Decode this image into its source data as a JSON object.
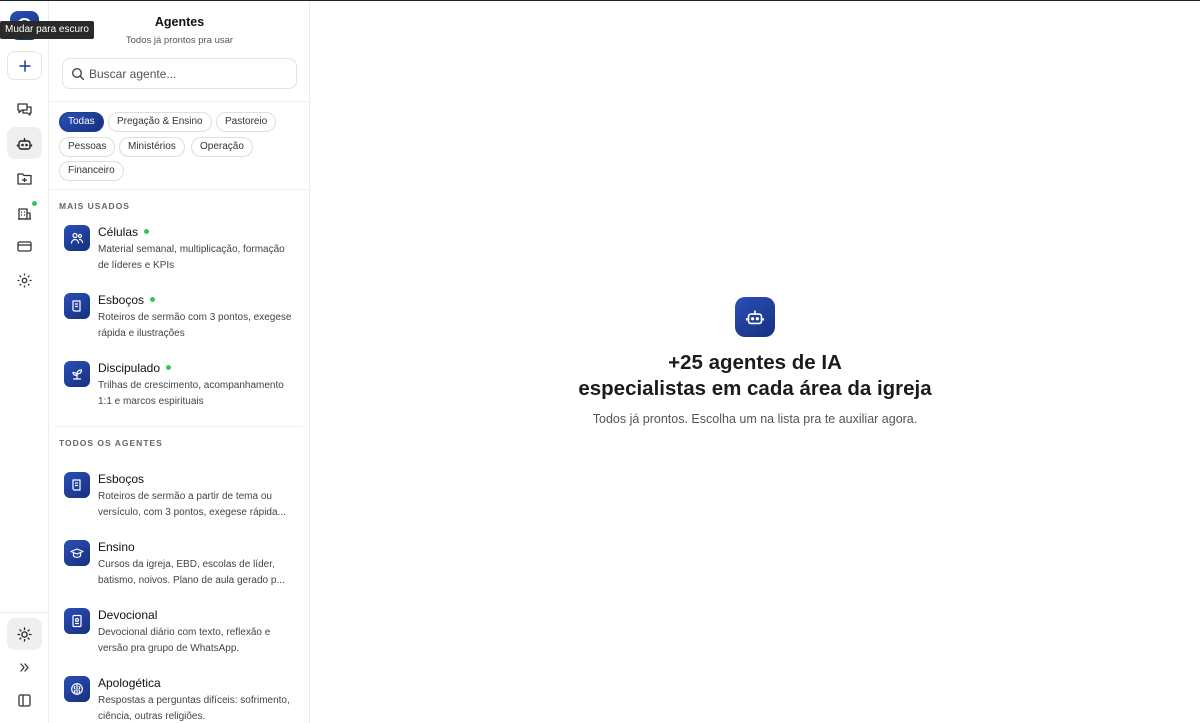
{
  "rail": {
    "tooltip": "Mudar para escuro",
    "items": [
      "chat-icon",
      "robot-icon",
      "folder-icon",
      "building-icon",
      "card-icon",
      "gear-icon"
    ],
    "bottom": [
      "sun-icon",
      "chevrons-right-icon",
      "sidebar-icon"
    ],
    "accent": "#1e3a8f",
    "badge_color": "#34c759"
  },
  "panel": {
    "title": "Agentes",
    "subtitle": "Todos já prontos pra usar",
    "search_placeholder": "Buscar agente...",
    "filters": [
      "Todas",
      "Pregação & Ensino",
      "Pastoreio",
      "Pessoas",
      "Ministérios",
      "Operação",
      "Financeiro"
    ],
    "active_filter": "Todas",
    "most_used_label": "MAIS USADOS",
    "most_used": [
      {
        "name": "Células",
        "desc": "Material semanal, multiplicação, formação de líderes e KPIs",
        "icon": "people-icon"
      },
      {
        "name": "Esboços",
        "desc": "Roteiros de sermão com 3 pontos, exegese rápida e ilustrações",
        "icon": "scroll-icon"
      },
      {
        "name": "Discipulado",
        "desc": "Trilhas de crescimento, acompanhamento 1:1 e marcos espirituais",
        "icon": "sprout-icon"
      }
    ],
    "all_label": "TODOS OS AGENTES",
    "all": [
      {
        "name": "Esboços",
        "desc": "Roteiros de sermão a partir de tema ou versículo, com 3 pontos, exegese rápida...",
        "icon": "scroll-icon"
      },
      {
        "name": "Ensino",
        "desc": "Cursos da igreja, EBD, escolas de líder, batismo, noivos. Plano de aula gerado p...",
        "icon": "graduation-cap-icon"
      },
      {
        "name": "Devocional",
        "desc": "Devocional diário com texto, reflexão e versão pra grupo de WhatsApp.",
        "icon": "book-icon"
      },
      {
        "name": "Apologética",
        "desc": "Respostas a perguntas difíceis: sofrimento, ciência, outras religiões.",
        "icon": "brain-icon"
      }
    ]
  },
  "main": {
    "title_line1": "+25 agentes de IA",
    "title_line2": "especialistas em cada área da igreja",
    "subtitle": "Todos já prontos. Escolha um na lista pra te auxiliar agora."
  }
}
